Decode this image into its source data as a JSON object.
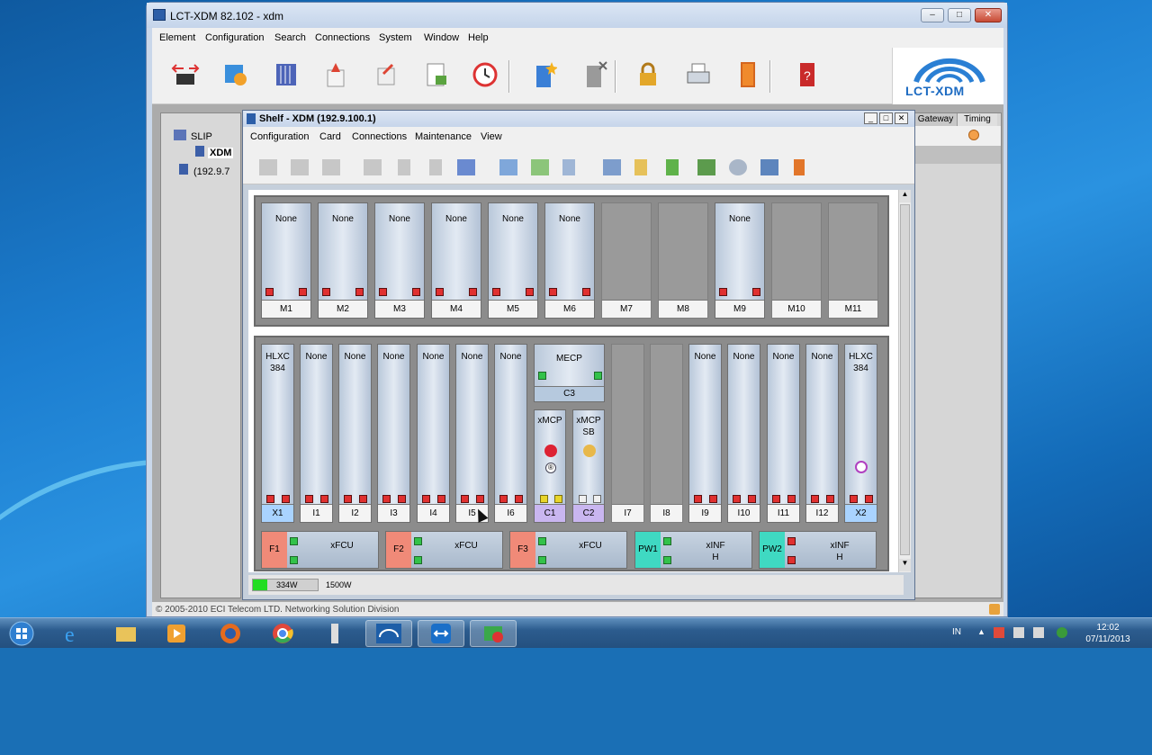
{
  "main_window": {
    "title": "LCT-XDM 82.102 - xdm",
    "menu": [
      "Element",
      "Configuration",
      "Search",
      "Connections",
      "System",
      "Window",
      "Help"
    ],
    "logo": "LCT-XDM",
    "status": "© 2005-2010 ECI Telecom LTD. Networking Solution Division"
  },
  "tree": {
    "items": [
      "SLIP",
      "XDM",
      "(192.9.7"
    ]
  },
  "right_pane": {
    "tabs": [
      "Gateway",
      "Timing"
    ]
  },
  "shelf_window": {
    "title": "Shelf - XDM (192.9.100.1)",
    "menu": [
      "Configuration",
      "Card",
      "Connections",
      "Maintenance",
      "View"
    ]
  },
  "top_rack": [
    {
      "label": "M1",
      "card": "None"
    },
    {
      "label": "M2",
      "card": "None"
    },
    {
      "label": "M3",
      "card": "None"
    },
    {
      "label": "M4",
      "card": "None"
    },
    {
      "label": "M5",
      "card": "None"
    },
    {
      "label": "M6",
      "card": "None"
    },
    {
      "label": "M7",
      "card": ""
    },
    {
      "label": "M8",
      "card": ""
    },
    {
      "label": "M9",
      "card": "None"
    },
    {
      "label": "M10",
      "card": ""
    },
    {
      "label": "M11",
      "card": ""
    }
  ],
  "bottom_rack": [
    {
      "label": "X1",
      "card": "HLXC 384"
    },
    {
      "label": "I1",
      "card": "None"
    },
    {
      "label": "I2",
      "card": "None"
    },
    {
      "label": "I3",
      "card": "None"
    },
    {
      "label": "I4",
      "card": "None"
    },
    {
      "label": "I5",
      "card": "None"
    },
    {
      "label": "I6",
      "card": "None"
    },
    {
      "label": "C1",
      "card": "xMCP"
    },
    {
      "label": "C2",
      "card": "xMCP SB"
    },
    {
      "label": "I7",
      "card": ""
    },
    {
      "label": "I8",
      "card": ""
    },
    {
      "label": "I9",
      "card": "None"
    },
    {
      "label": "I10",
      "card": "None"
    },
    {
      "label": "I11",
      "card": "None"
    },
    {
      "label": "I12",
      "card": "None"
    },
    {
      "label": "X2",
      "card": "HLXC 384"
    }
  ],
  "c3": {
    "label": "C3",
    "card": "MECP"
  },
  "psus": [
    {
      "tag": "F1",
      "name": "xFCU",
      "color": "#f08a78"
    },
    {
      "tag": "F2",
      "name": "xFCU",
      "color": "#f08a78"
    },
    {
      "tag": "F3",
      "name": "xFCU",
      "color": "#f08a78"
    },
    {
      "tag": "PW1",
      "name": "xINF H",
      "color": "#3fd9c2"
    },
    {
      "tag": "PW2",
      "name": "xINF H",
      "color": "#3fd9c2"
    }
  ],
  "power": {
    "used": "334W",
    "total": "1500W"
  },
  "clock": {
    "time": "12:02",
    "date": "07/11/2013"
  },
  "lang": "IN"
}
